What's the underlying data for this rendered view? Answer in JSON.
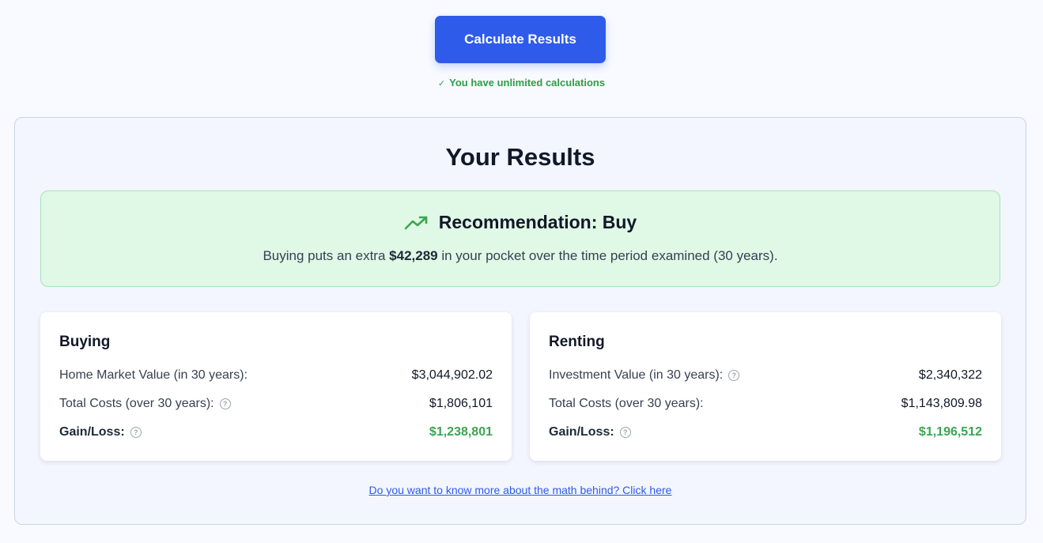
{
  "actions": {
    "calculate_label": "Calculate Results",
    "unlimited_note": "You have unlimited calculations"
  },
  "results": {
    "title": "Your Results",
    "recommendation": {
      "heading": "Recommendation: Buy",
      "text_prefix": "Buying puts an extra ",
      "amount": "$42,289",
      "text_suffix": " in your pocket over the time period examined (30 years).",
      "icon": "trending-up-icon",
      "accent_color": "#3aa651"
    },
    "buying": {
      "title": "Buying",
      "rows": [
        {
          "label": "Home Market Value (in 30 years):",
          "value": "$3,044,902.02"
        },
        {
          "label": "Total Costs (over 30 years):",
          "value": "$1,806,101"
        },
        {
          "label": "Gain/Loss:",
          "value": "$1,238,801"
        }
      ]
    },
    "renting": {
      "title": "Renting",
      "rows": [
        {
          "label": "Investment Value (in 30 years):",
          "value": "$2,340,322"
        },
        {
          "label": "Total Costs (over 30 years):",
          "value": "$1,143,809.98"
        },
        {
          "label": "Gain/Loss:",
          "value": "$1,196,512"
        }
      ]
    },
    "math_link": "Do you want to know more about the math behind? Click here"
  },
  "colors": {
    "primary": "#2f5bea",
    "success": "#3aa651"
  }
}
